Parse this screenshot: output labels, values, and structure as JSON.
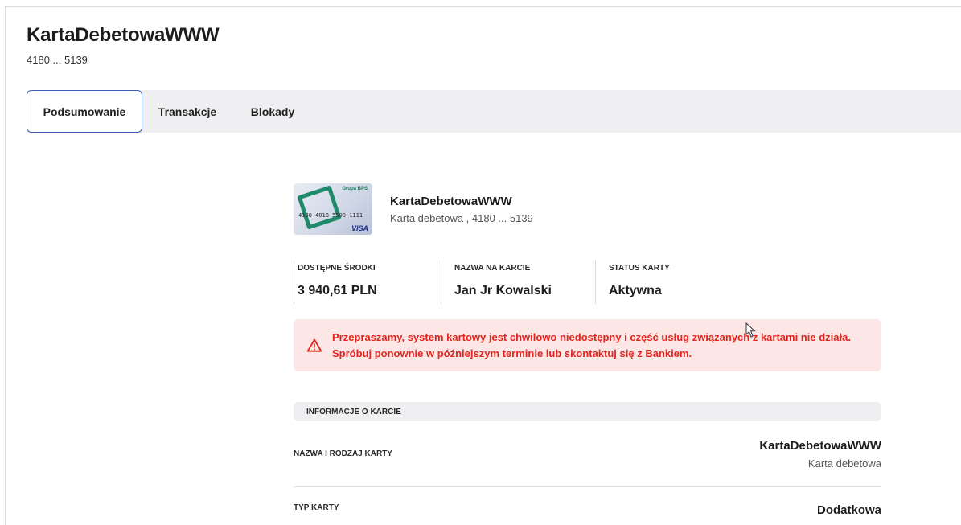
{
  "header": {
    "title": "KartaDebetowaWWW",
    "card_number": "4180 ... 5139"
  },
  "tabs": [
    {
      "label": "Podsumowanie",
      "active": true
    },
    {
      "label": "Transakcje",
      "active": false
    },
    {
      "label": "Blokady",
      "active": false
    }
  ],
  "card": {
    "name": "KartaDebetowaWWW",
    "description": "Karta debetowa , 4180 ... 5139",
    "image": {
      "bank_logo": "Grupa BPS",
      "number": "4180 4018 5500 1111",
      "brand": "VISA"
    }
  },
  "stats": [
    {
      "label": "DOSTĘPNE ŚRODKI",
      "value": "3 940,61 PLN"
    },
    {
      "label": "NAZWA NA KARCIE",
      "value": "Jan Jr Kowalski"
    },
    {
      "label": "STATUS KARTY",
      "value": "Aktywna"
    }
  ],
  "alert": {
    "icon": "warning-icon",
    "color": "#e0261e",
    "background": "#fde6e6",
    "line1": "Przepraszamy, system kartowy jest chwilowo niedostępny i część usług związanych z kartami nie działa.",
    "line2": "Spróbuj ponownie w późniejszym terminie lub skontaktuj się z Bankiem."
  },
  "info_section": {
    "heading": "INFORMACJE O KARCIE",
    "rows": [
      {
        "label": "NAZWA I RODZAJ KARTY",
        "value": "KartaDebetowaWWW",
        "sub": "Karta debetowa"
      },
      {
        "label": "TYP KARTY",
        "value": "Dodatkowa",
        "sub": ""
      }
    ]
  },
  "colors": {
    "accent": "#3b5bb5",
    "tab_bar": "#efeff1"
  }
}
